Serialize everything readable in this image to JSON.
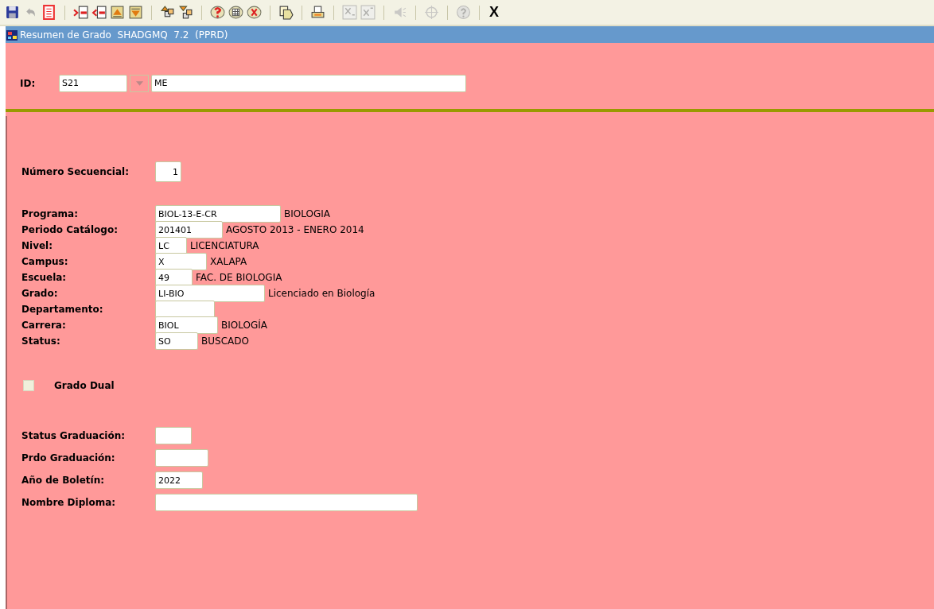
{
  "toolbar": {
    "groups": [
      [
        {
          "disabled": false
        },
        {
          "disabled": true
        },
        {
          "disabled": false
        }
      ],
      [
        {
          "disabled": false
        },
        {
          "disabled": false
        },
        {
          "disabled": false
        },
        {
          "disabled": false
        }
      ],
      [
        {
          "disabled": false
        },
        {
          "disabled": false
        }
      ],
      [
        {
          "disabled": false
        },
        {
          "disabled": false
        },
        {
          "disabled": false
        }
      ],
      [
        {
          "disabled": false
        }
      ],
      [
        {
          "disabled": false
        }
      ],
      [
        {
          "disabled": true
        },
        {
          "disabled": true
        }
      ],
      [
        {
          "disabled": true
        }
      ],
      [
        {
          "disabled": true
        }
      ],
      [
        {
          "disabled": true
        }
      ]
    ],
    "close_label": "X"
  },
  "window": {
    "title": "Resumen de Grado  SHADGMQ  7.2  (PPRD)"
  },
  "key_block": {
    "label": "ID:",
    "id_value": "S21",
    "name_value": "ME"
  },
  "sequence": {
    "label": "Número Secuencial:",
    "value": "1"
  },
  "fields": [
    {
      "label": "Programa:",
      "value": "BIOL-13-E-CR",
      "description": "BIOLOGIA"
    },
    {
      "label": "Periodo Catálogo:",
      "value": "201401",
      "description": "AGOSTO 2013 - ENERO 2014"
    },
    {
      "label": "Nivel:",
      "value": "LC",
      "description": "LICENCIATURA"
    },
    {
      "label": "Campus:",
      "value": "X",
      "description": "XALAPA"
    },
    {
      "label": "Escuela:",
      "value": "49",
      "description": "FAC. DE BIOLOGIA"
    },
    {
      "label": "Grado:",
      "value": "LI-BIO",
      "description": "Licenciado en Biología"
    },
    {
      "label": "Departamento:"
    },
    {
      "label": "Carrera:",
      "value": "BIOL",
      "description": "BIOLOGÍA"
    },
    {
      "label": "Status:",
      "value": "SO",
      "description": "BUSCADO"
    }
  ],
  "dual": {
    "label": "Grado Dual",
    "checked": false
  },
  "graduation_fields": [
    {
      "label": "Status Graduación:"
    },
    {
      "label": "Prdo Graduación:"
    },
    {
      "label": "Año de Boletín:",
      "value": "2022"
    },
    {
      "label": "Nombre Diploma:"
    }
  ]
}
